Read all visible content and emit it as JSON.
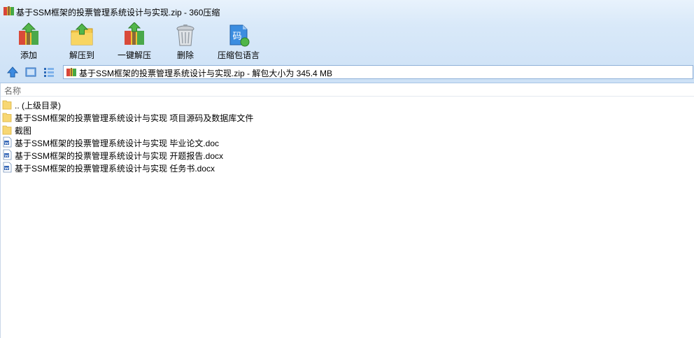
{
  "window": {
    "title": "基于SSM框架的投票管理系统设计与实现.zip - 360压缩",
    "app_icon": "archive-icon"
  },
  "toolbar": {
    "buttons": [
      {
        "label": "添加",
        "icon": "add-archive-icon"
      },
      {
        "label": "解压到",
        "icon": "extract-to-icon"
      },
      {
        "label": "一键解压",
        "icon": "one-click-extract-icon"
      },
      {
        "label": "删除",
        "icon": "trash-icon"
      },
      {
        "label": "压缩包语言",
        "icon": "encoding-icon",
        "icon_text": "码"
      }
    ]
  },
  "navbar": {
    "path": "基于SSM框架的投票管理系统设计与实现.zip - 解包大小为 345.4 MB"
  },
  "list": {
    "column_name": "名称",
    "items": [
      {
        "name": ".. (上级目录)",
        "type": "folder"
      },
      {
        "name": "基于SSM框架的投票管理系统设计与实现  项目源码及数据库文件",
        "type": "folder"
      },
      {
        "name": "截图",
        "type": "folder"
      },
      {
        "name": "基于SSM框架的投票管理系统设计与实现 毕业论文.doc",
        "type": "word"
      },
      {
        "name": "基于SSM框架的投票管理系统设计与实现 开题报告.docx",
        "type": "word"
      },
      {
        "name": "基于SSM框架的投票管理系统设计与实现 任务书.docx",
        "type": "word"
      }
    ]
  },
  "colors": {
    "toolbar_bg": "#d9e9f9",
    "folder": "#f7d774",
    "word_icon": "#2b5fb3",
    "accent_blue": "#2e7bd6"
  }
}
